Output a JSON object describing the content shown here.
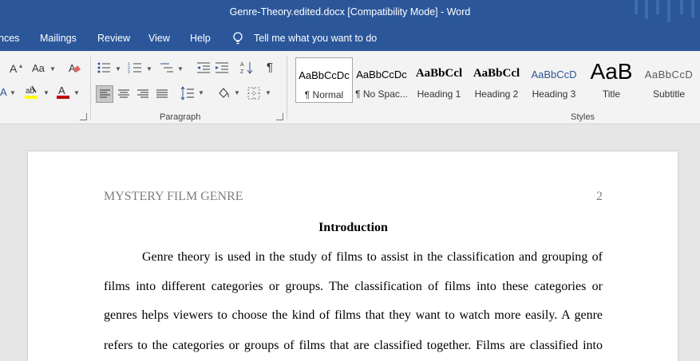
{
  "window": {
    "title": "Genre-Theory.edited.docx [Compatibility Mode]  -  Word"
  },
  "tabs": [
    {
      "label": "nces"
    },
    {
      "label": "Mailings"
    },
    {
      "label": "Review"
    },
    {
      "label": "View"
    },
    {
      "label": "Help"
    }
  ],
  "tell_me": {
    "label": "Tell me what you want to do",
    "icon": "lightbulb-icon"
  },
  "ribbon": {
    "font_group": {
      "grow_font": "A",
      "change_case": "Aa"
    },
    "paragraph_group": {
      "label": "Paragraph",
      "show_marks": "¶"
    },
    "styles_group": {
      "label": "Styles",
      "items": [
        {
          "preview": "AaBbCcDc",
          "name": "¶ Normal",
          "selected": true
        },
        {
          "preview": "AaBbCcDc",
          "name": "¶ No Spac..."
        },
        {
          "preview": "AaBbCcl",
          "name": "Heading 1"
        },
        {
          "preview": "AaBbCcl",
          "name": "Heading 2"
        },
        {
          "preview": "AaBbCcD",
          "name": "Heading 3"
        },
        {
          "preview": "AaB",
          "name": "Title"
        },
        {
          "preview": "AaBbCcD",
          "name": "Subtitle"
        }
      ]
    }
  },
  "colors": {
    "title_bar": "#2b579a",
    "highlight": "#ffff00",
    "font_color": "#c00000",
    "heading_blue": "#2f5496"
  },
  "document": {
    "running_head": "MYSTERY FILM GENRE",
    "page_number": "2",
    "heading": "Introduction",
    "lines": [
      "Genre theory is used in the study of films to assist in the classification and grouping of",
      "films into different categories or groups. The classification of films into these categories or",
      "genres helps viewers to choose the kind of films that they want to watch more easily. A genre",
      "refers to the categories or groups of films that are classified together. Films are classified into"
    ]
  }
}
